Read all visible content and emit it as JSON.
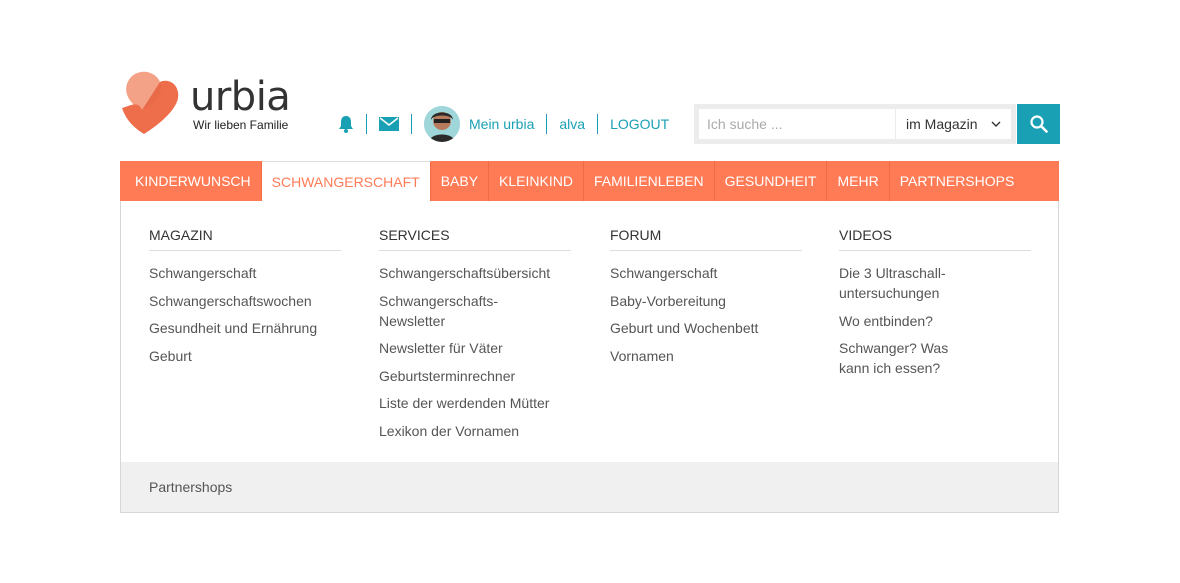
{
  "brand": {
    "name": "urbia",
    "tagline": "Wir lieben Familie",
    "accent": "#ff7b56",
    "teal": "#1aa0b4"
  },
  "usernav": {
    "bell_icon": "bell-icon",
    "mail_icon": "mail-icon",
    "my_label": "Mein urbia",
    "username": "alva",
    "logout": "LOGOUT"
  },
  "search": {
    "placeholder": "Ich suche ...",
    "scope": "im Magazin",
    "button_icon": "search-icon"
  },
  "nav": [
    {
      "label": "KINDERWUNSCH"
    },
    {
      "label": "SCHWANGERSCHAFT",
      "active": true
    },
    {
      "label": "BABY"
    },
    {
      "label": "KLEINKIND"
    },
    {
      "label": "FAMILIENLEBEN"
    },
    {
      "label": "GESUNDHEIT"
    },
    {
      "label": "MEHR"
    },
    {
      "label": "PARTNERSHOPS"
    }
  ],
  "dropdown": {
    "columns": [
      {
        "title": "MAGAZIN",
        "items": [
          "Schwangerschaft",
          "Schwangerschaftswochen",
          "Gesundheit und Ernährung",
          "Geburt"
        ]
      },
      {
        "title": "SERVICES",
        "items": [
          "Schwangerschaftsübersicht",
          "Schwangerschafts-Newsletter",
          "Newsletter für Väter",
          "Geburtsterminrechner",
          "Liste der werdenden Mütter",
          "Lexikon der Vornamen"
        ]
      },
      {
        "title": "FORUM",
        "items": [
          "Schwangerschaft",
          "Baby-Vorbereitung",
          "Geburt und Wochenbett",
          "Vornamen"
        ]
      },
      {
        "title": "VIDEOS",
        "items": [
          "Die 3 Ultraschall-untersuchungen",
          "Wo entbinden?",
          "Schwanger? Was kann ich essen?"
        ]
      }
    ],
    "footer": "Partnershops"
  }
}
